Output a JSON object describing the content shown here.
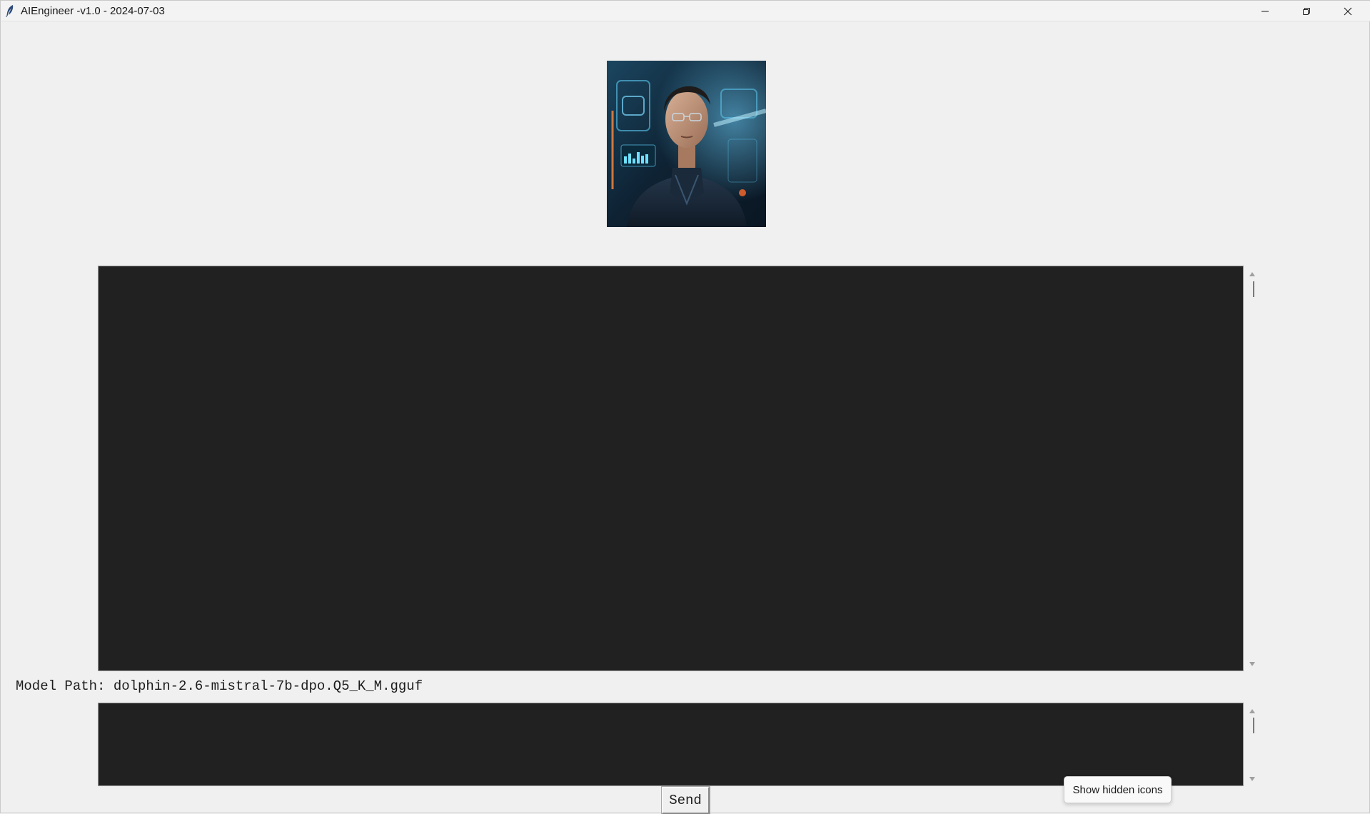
{
  "window": {
    "title": "AIEngineer -v1.0 - 2024-07-03",
    "app_icon": "feather-icon",
    "controls": {
      "minimize": "minimize-icon",
      "restore": "restore-icon",
      "close": "close-icon"
    }
  },
  "avatar": {
    "description_icon": "avatar-image"
  },
  "output": {
    "text": ""
  },
  "model_path": {
    "label": "Model Path: dolphin-2.6-mistral-7b-dpo.Q5_K_M.gguf"
  },
  "input": {
    "text": ""
  },
  "send_button": {
    "label": "Send"
  },
  "tooltip": {
    "text": "Show hidden icons"
  },
  "colors": {
    "window_bg": "#f0f0f0",
    "textarea_bg": "#212121",
    "text": "#1c1c1c"
  }
}
